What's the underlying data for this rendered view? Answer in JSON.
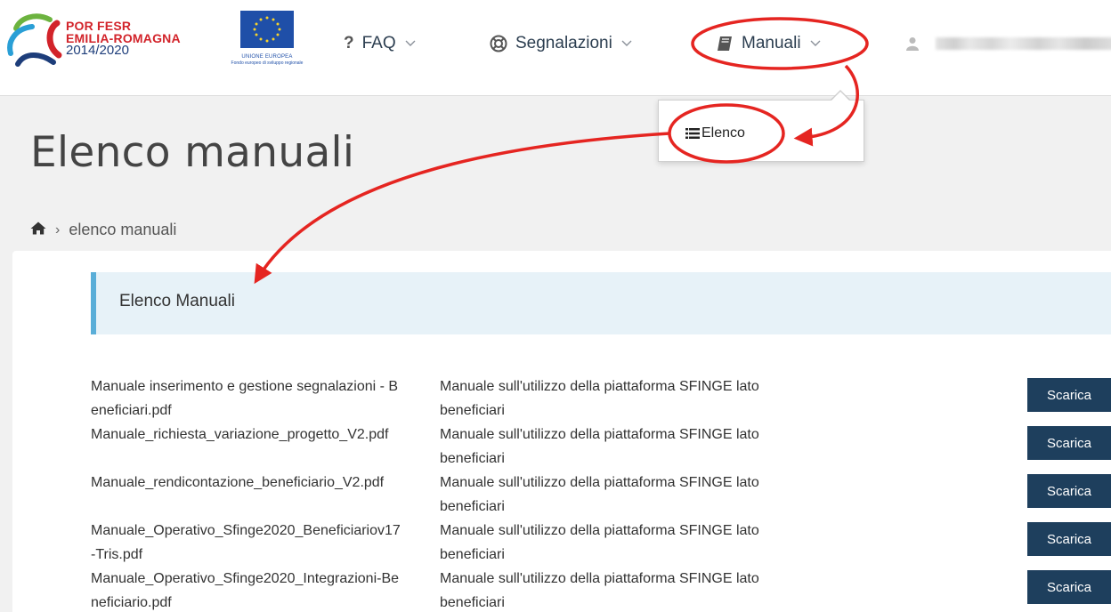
{
  "brand": {
    "por_line1": "POR FESR",
    "por_line2": "EMILIA-ROMAGNA",
    "por_line3": "2014/2020",
    "eu_line1": "UNIONE EUROPEA",
    "eu_line2": "Fondo europeo di sviluppo regionale"
  },
  "nav": {
    "faq": "FAQ",
    "segnalazioni": "Segnalazioni",
    "manuali": "Manuali"
  },
  "dropdown": {
    "elenco": "Elenco"
  },
  "page": {
    "title": "Elenco manuali",
    "breadcrumb_current": "elenco manuali"
  },
  "section": {
    "title": "Elenco Manuali"
  },
  "files": [
    {
      "name": "Manuale inserimento e gestione segnalazioni - Beneficiari.pdf",
      "description": "Manuale sull'utilizzo della piattaforma SFINGE lato beneficiari",
      "button": "Scarica"
    },
    {
      "name": "Manuale_richiesta_variazione_progetto_V2.pdf",
      "description": "Manuale sull'utilizzo della piattaforma SFINGE lato beneficiari",
      "button": "Scarica"
    },
    {
      "name": "Manuale_rendicontazione_beneficiario_V2.pdf",
      "description": "Manuale sull'utilizzo della piattaforma SFINGE lato beneficiari",
      "button": "Scarica"
    },
    {
      "name": "Manuale_Operativo_Sfinge2020_Beneficiariov17-Tris.pdf",
      "description": "Manuale sull'utilizzo della piattaforma SFINGE lato beneficiari",
      "button": "Scarica"
    },
    {
      "name": "Manuale_Operativo_Sfinge2020_Integrazioni-Beneficiario.pdf",
      "description": "Manuale sull'utilizzo della piattaforma SFINGE lato beneficiari",
      "button": "Scarica"
    }
  ],
  "colors": {
    "button_bg": "#1e3f5d",
    "section_bg": "#e7f2f8",
    "section_accent": "#5aaed8",
    "annotation": "#e52521",
    "brand_red": "#d2232a",
    "brand_blue": "#1d3d7a"
  }
}
